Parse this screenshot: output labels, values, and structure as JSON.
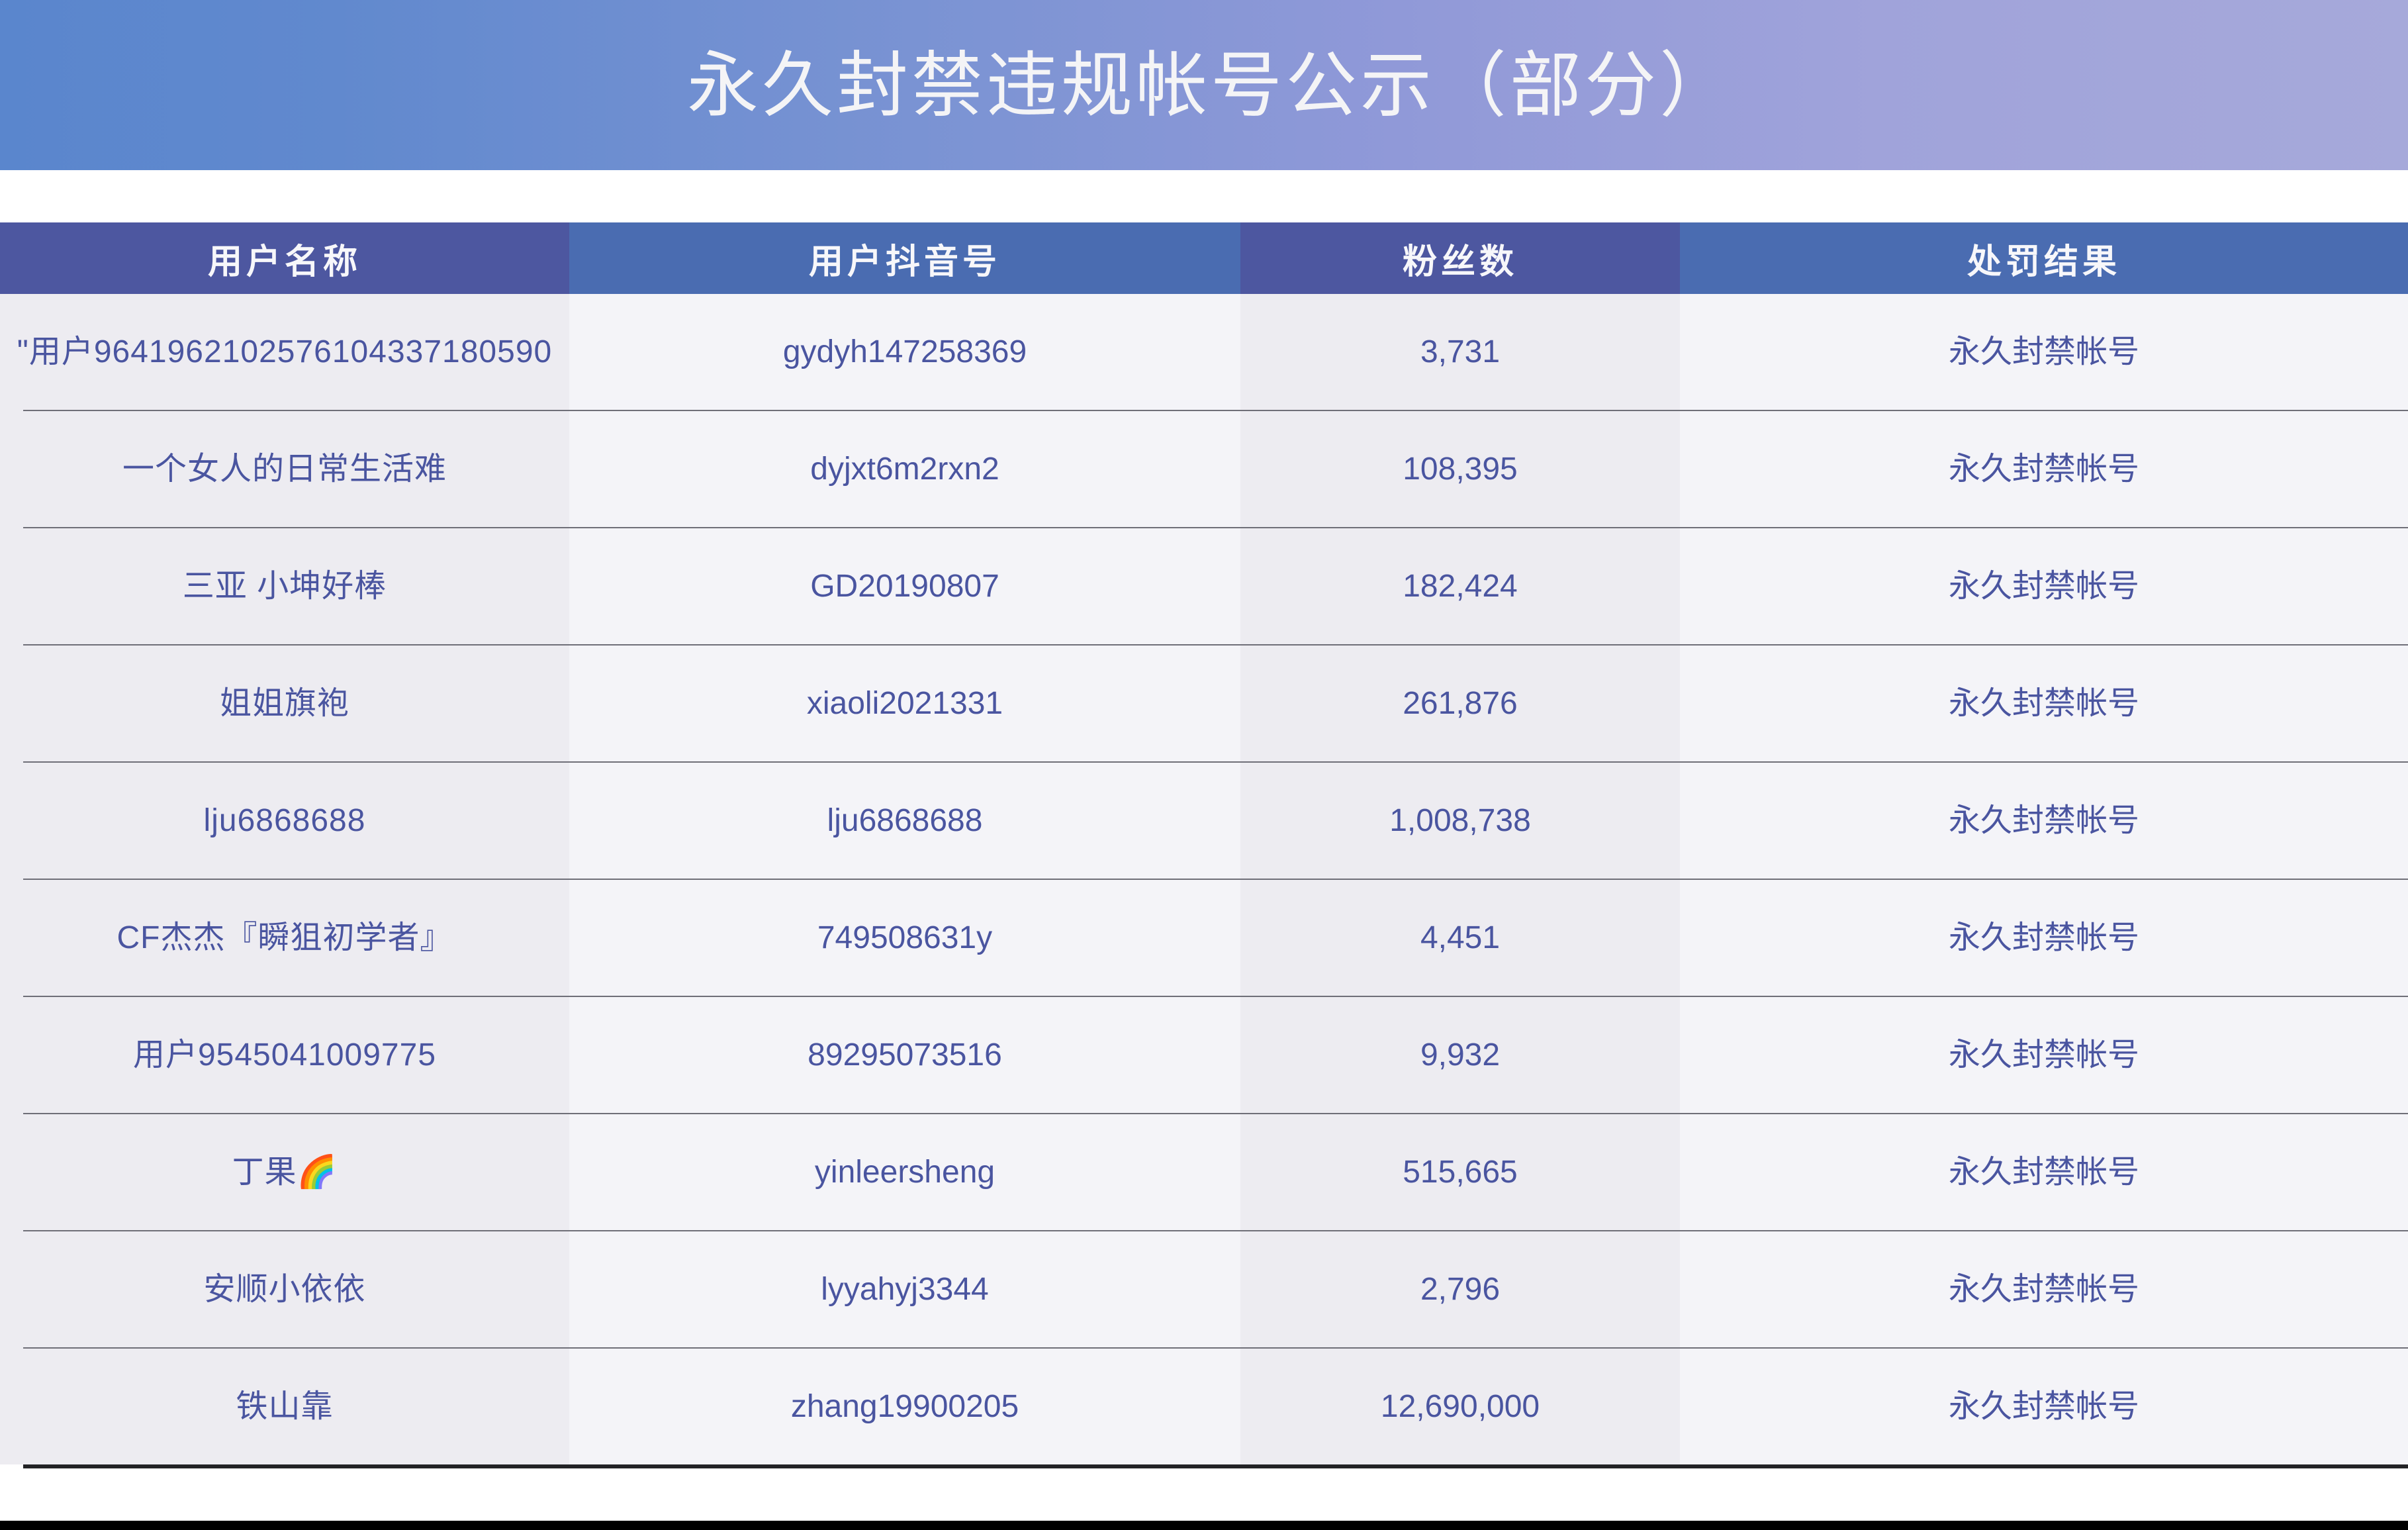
{
  "banner": {
    "title": "永久封禁违规帐号公示（部分）",
    "gradient_from": "#5a86cd",
    "gradient_to": "#a6a9da",
    "title_color": "#f4f4f6"
  },
  "table": {
    "header_dark_color": "#4d57a0",
    "header_light_color": "#4a6cb1",
    "row_text_color": "#4a55a0",
    "row_bg_a": "#edecf1",
    "row_bg_b": "#f4f4f8",
    "columns": [
      {
        "key": "user_name",
        "label": "用户名称"
      },
      {
        "key": "douyin_id",
        "label": "用户抖音号"
      },
      {
        "key": "fans",
        "label": "粉丝数"
      },
      {
        "key": "penalty",
        "label": "处罚结果"
      }
    ],
    "rows": [
      {
        "user_name": "\"用户9641962102576104337180590",
        "douyin_id": "gydyh147258369",
        "fans": "3,731",
        "penalty": "永久封禁帐号"
      },
      {
        "user_name": "一个女人的日常生活难",
        "douyin_id": "dyjxt6m2rxn2",
        "fans": "108,395",
        "penalty": "永久封禁帐号"
      },
      {
        "user_name": "三亚 小坤好棒",
        "douyin_id": "GD20190807",
        "fans": "182,424",
        "penalty": "永久封禁帐号"
      },
      {
        "user_name": "姐姐旗袍",
        "douyin_id": "xiaoli2021331",
        "fans": "261,876",
        "penalty": "永久封禁帐号"
      },
      {
        "user_name": "lju6868688",
        "douyin_id": "lju6868688",
        "fans": "1,008,738",
        "penalty": "永久封禁帐号"
      },
      {
        "user_name": "CF杰杰『瞬狙初学者』",
        "douyin_id": "749508631y",
        "fans": "4,451",
        "penalty": "永久封禁帐号"
      },
      {
        "user_name": "用户9545041009775",
        "douyin_id": "89295073516",
        "fans": "9,932",
        "penalty": "永久封禁帐号"
      },
      {
        "user_name": "丁果🌈",
        "douyin_id": "yinleersheng",
        "fans": "515,665",
        "penalty": "永久封禁帐号"
      },
      {
        "user_name": "安顺小依依",
        "douyin_id": "lyyahyj3344",
        "fans": "2,796",
        "penalty": "永久封禁帐号"
      },
      {
        "user_name": "铁山靠",
        "douyin_id": "zhang19900205",
        "fans": "12,690,000",
        "penalty": "永久封禁帐号"
      }
    ]
  }
}
